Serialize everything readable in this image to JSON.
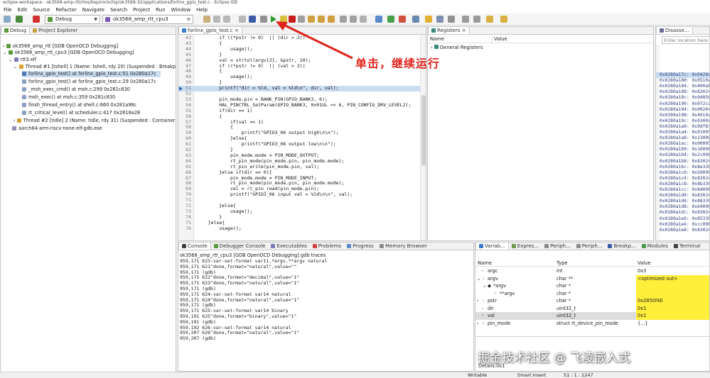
{
  "window": {
    "title": "eclipse-workspace - ok3568-amp-rtt/rtos/bsp/rockchip/ok3568-32/applications/forlinx_gpio_test.c - Eclipse IDE"
  },
  "menu": [
    "File",
    "Edit",
    "Source",
    "Refactor",
    "Navigate",
    "Search",
    "Project",
    "Run",
    "Window",
    "Help"
  ],
  "toolbar": {
    "mode": "Debug",
    "config": "ok3568_amp_rtt_cpu3"
  },
  "debug_view": {
    "tabs": [
      "Debug",
      "Project Explorer"
    ],
    "items": [
      "ok3568_amp_rtt [GDB OpenOCD Debugging]",
      "ok3568_amp_rtt_cpu3 [GDB OpenOCD Debugging]",
      "rtt3.elf",
      "Thread #1 [tshell] 1 (Name: tshell, rdy 20) (Suspended : Breakpoint)",
      "forlinx_gpio_test() at forlinx_gpio_test.c:51 0x280a17c",
      "forlinx_gpio_test() at forlinx_gpio_test.c:29 0x280a17c",
      "_msh_exec_cmd() at msh.c:299 0x281c830",
      "msh_exec() at msh.c:359 0x281c830",
      "finsh_thread_entry() at shell.c:660 0x281a98c",
      "rt_critical_level() at scheduler.c:417 0x2818a28",
      "Thread #2 [tidle] 2 (Name: tidle, rdy 31) (Suspended : Container)",
      "aarch64-arm-riscv-none-elf-gdb.exe"
    ]
  },
  "editor": {
    "tab": "forlinx_gpio_test.c",
    "line_numbers": [
      "42",
      "43",
      "44",
      "45",
      "46",
      "47",
      "48",
      "49",
      "50",
      "51",
      "52",
      "53",
      "54",
      "55",
      "56",
      "57",
      "58",
      "59",
      "60",
      "61",
      "62",
      "63",
      "64",
      "65",
      "66",
      "67",
      "68",
      "69",
      "70",
      "71",
      "72",
      "73",
      "74",
      "75",
      "76"
    ],
    "lines": [
      "        if ((*pstr != 0)  || (dir > 2))",
      "        {",
      "            usage();",
      "        }",
      "        val = strtol(argv[2], &pstr, 10);",
      "        if ((*pstr != 0)  || (val > 2))",
      "        {",
      "            usage();",
      "        }",
      "        printf(\"dir = %ld, val = %ld\\n\", dir, val);",
      "",
      "        pin_mode.pin = BANK_PIN(GPIO_BANK3, 6);",
      "        HAL_PINCTRL_SetParam(GPIO_BANK3, 0x01UL << 6, PIN_CONFIG_DRV_LEVEL2);   //e",
      "        if(dir == 1)",
      "        {",
      "            if(val == 1)",
      "            {",
      "                printf(\"GPIO3_06 output high\\n\\n\");",
      "            }else{",
      "                printf(\"GPIO3_06 output low\\n\\n\");",
      "            }",
      "            pin_mode.mode = PIN_MODE_OUTPUT;",
      "            rt_pin_mode(pin_mode.pin, pin_mode.mode);",
      "            rt_pin_write(pin_mode.pin, val);",
      "        }else if(dir == 0){",
      "            pin_mode.mode = PIN_MODE_INPUT;",
      "            rt_pin_mode(pin_mode.pin, pin_mode.mode);",
      "            val = rt_pin_read(pin_mode.pin);",
      "            printf(\"GPIO3_06 input val = %ld\\n\\n\", val);",
      "",
      "        }else{",
      "            usage();",
      "        }",
      "    }else{",
      "        usage();"
    ]
  },
  "registers": {
    "tab": "Registers",
    "col_name": "Name",
    "col_value": "Value",
    "group": "General Registers"
  },
  "disassembly": {
    "tab": "Disasse...",
    "placeholder": "Enter location here",
    "lines": [
      "0x0280a17c: 0x0420a0e",
      "0x0280a180: 0x0510a0e",
      "0x0280a184: 0x400a05e",
      "0x0280a188: 0x830240e",
      "0x0280a18c: 0x9d8500f",
      "0x0280a190: 0x072ca0e",
      "0x0280a194: 0x00204le",
      "0x0280a198: 0x4010a0e",
      "0x0280a19c: 0x0300a0e",
      "0x0280a1a0: 0x9df8ffe",
      "0x0280a1a4: 0x010055e",
      "0x0280a1a8: 0x2300000",
      "0x0280a1ac: 0x000055e",
      "0x0280a1b0: 0x1600000",
      "0x0280a1b4: 0x2c0905e",
      "0x0280a1b8: 0x830240e",
      "0x0280a1bc: 0x8e3300e",
      "0x0280a1c0: 0x500905e",
      "0x0280a1c4: 0x830240e",
      "0x0280a1c8: 0x8b3300e",
      "0x0280a1cc: 0x840905e",
      "0x0280a1d0: 0x830240e",
      "0x0280a1d4: 0x883300e",
      "0x0280a1d8: 0xb40905e",
      "0x0280a1dc: 0x830240e",
      "0x0280a1e0: 0x853300e",
      "0x0280a1e4: 0xcc0905e",
      "0x0280a1e8: 0x830240e"
    ]
  },
  "console": {
    "tabs": [
      "Console",
      "Debugger Console",
      "Executables",
      "Problems",
      "Progress",
      "Memory Browser"
    ],
    "title": "ok3568_amp_rtt_cpu3 [GDB OpenOCD Debugging] gdb traces",
    "lines": [
      "959,171 623-var-set-format var11.*argv.**argv natural",
      "959,171 621^done,format=\"natural\",value=\"\"",
      "959,171 (gdb)",
      "959,171 622^done,format=\"decimal\",value=\"1\"",
      "959,171 623^done,format=\"natural\",value=\"1\"",
      "959,171 (gdb)",
      "959,171 624-var-set-format var14 natural",
      "959,171 624^done,format=\"natural\",value=\"1\"",
      "959,171 (gdb)",
      "959,171 625-var-set-format var14 binary",
      "959,191 625^done,format=\"binary\",value=\"1\"",
      "959,191 (gdb)",
      "959,192 626-var-set-format var14 natural",
      "959,207 626^done,format=\"natural\",value=\"1\"",
      "959,207 (gdb)"
    ]
  },
  "variables": {
    "tabs": [
      "Variab...",
      "Expres...",
      "Periph...",
      "Periph...",
      "Breakp...",
      "Modules",
      "Terminal"
    ],
    "col_name": "Name",
    "col_type": "Type",
    "col_value": "Value",
    "rows": [
      {
        "name": "argc",
        "type": "int",
        "value": "0x3"
      },
      {
        "name": "argv",
        "type": "char **",
        "value": "<optimized out>"
      },
      {
        "name": "*argv",
        "type": "char *",
        "value": ""
      },
      {
        "name": "**argv",
        "type": "char *",
        "value": ""
      },
      {
        "name": "pstr",
        "type": "char *",
        "value": "0x2850f40"
      },
      {
        "name": "dir",
        "type": "uint32_t",
        "value": "0x1"
      },
      {
        "name": "val",
        "type": "uint32_t",
        "value": "0x1"
      },
      {
        "name": "pin_mode",
        "type": "struct rt_device_pin_mode",
        "value": "{...}"
      }
    ],
    "detail": "Details:0x1"
  },
  "annotation": "单击，继续运行",
  "watermark": "掘金技术社区 @ 飞凌嵌入式",
  "status": {
    "writable": "Writable",
    "insert": "Smart Insert",
    "position": "51 : 1 : 1247"
  },
  "colors": {
    "accent": "#e0231c",
    "highlight": "#ffef3a",
    "selection": "#c9dcf0"
  }
}
